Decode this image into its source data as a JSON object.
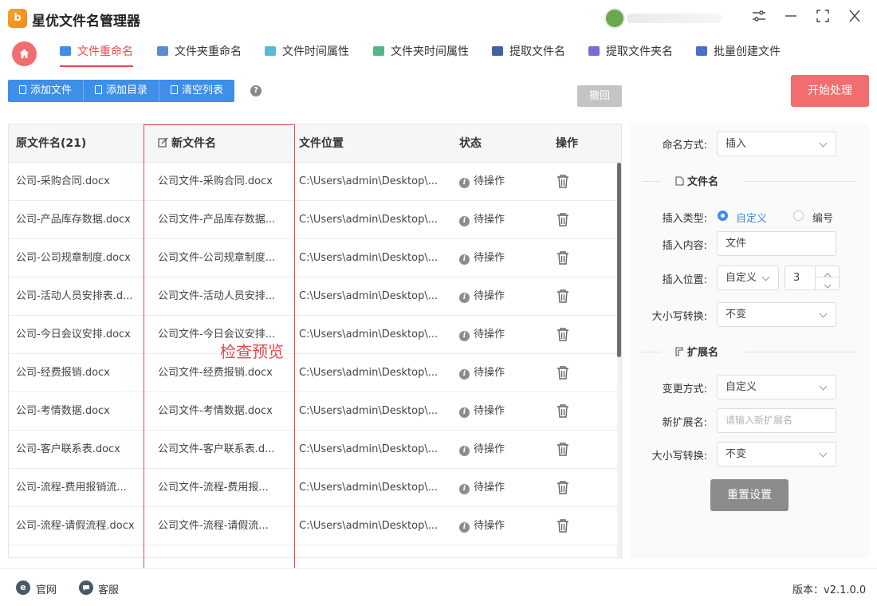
{
  "app": {
    "title": "星优文件名管理器",
    "logo_text": "b"
  },
  "tabs": [
    {
      "label": "文件重命名",
      "active": true,
      "icon": "rename-icon",
      "color": "#3d8fe8"
    },
    {
      "label": "文件夹重命名",
      "icon": "folder-rename-icon",
      "color": "#5d8ccf"
    },
    {
      "label": "文件时间属性",
      "icon": "file-time-icon",
      "color": "#5ab7d6"
    },
    {
      "label": "文件夹时间属性",
      "icon": "folder-time-icon",
      "color": "#4fb88a"
    },
    {
      "label": "提取文件名",
      "icon": "extract-filename-icon",
      "color": "#3e63a8"
    },
    {
      "label": "提取文件夹名",
      "icon": "extract-foldername-icon",
      "color": "#7c6ad6"
    },
    {
      "label": "批量创建文件",
      "icon": "batch-create-icon",
      "color": "#4a6fd0"
    }
  ],
  "toolbar": {
    "add_file": "添加文件",
    "add_dir": "添加目录",
    "clear_list": "清空列表",
    "help": "?",
    "undo": "撤回",
    "start": "开始处理"
  },
  "table": {
    "headers": {
      "original": "原文件名(21)",
      "new": "新文件名",
      "location": "文件位置",
      "status": "状态",
      "action": "操作"
    },
    "rows": [
      {
        "original": "公司-采购合同.docx",
        "new": "公司文件-采购合同.docx",
        "location": "C:\\Users\\admin\\Desktop\\...",
        "status": "待操作"
      },
      {
        "original": "公司-产品库存数据.docx",
        "new": "公司文件-产品库存数据...",
        "location": "C:\\Users\\admin\\Desktop\\...",
        "status": "待操作"
      },
      {
        "original": "公司-公司规章制度.docx",
        "new": "公司文件-公司规章制度...",
        "location": "C:\\Users\\admin\\Desktop\\...",
        "status": "待操作"
      },
      {
        "original": "公司-活动人员安排表.d...",
        "new": "公司文件-活动人员安排...",
        "location": "C:\\Users\\admin\\Desktop\\...",
        "status": "待操作"
      },
      {
        "original": "公司-今日会议安排.docx",
        "new": "公司文件-今日会议安排...",
        "location": "C:\\Users\\admin\\Desktop\\...",
        "status": "待操作"
      },
      {
        "original": "公司-经费报销.docx",
        "new": "公司文件-经费报销.docx",
        "location": "C:\\Users\\admin\\Desktop\\...",
        "status": "待操作"
      },
      {
        "original": "公司-考情数据.docx",
        "new": "公司文件-考情数据.docx",
        "location": "C:\\Users\\admin\\Desktop\\...",
        "status": "待操作"
      },
      {
        "original": "公司-客户联系表.docx",
        "new": "公司文件-客户联系表.d...",
        "location": "C:\\Users\\admin\\Desktop\\...",
        "status": "待操作"
      },
      {
        "original": "公司-流程-费用报销流...",
        "new": "公司文件-流程-费用报...",
        "location": "C:\\Users\\admin\\Desktop\\...",
        "status": "待操作"
      },
      {
        "original": "公司-流程-请假流程.docx",
        "new": "公司文件-流程-请假流...",
        "location": "C:\\Users\\admin\\Desktop\\...",
        "status": "待操作"
      },
      {
        "original": "",
        "new": "",
        "location": "",
        "status": ""
      }
    ]
  },
  "annotation": {
    "preview_label": "检查预览",
    "color": "#e24b4b"
  },
  "panel": {
    "naming_method_label": "命名方式:",
    "naming_method_value": "插入",
    "filename_section": "文件名",
    "insert_type_label": "插入类型:",
    "insert_type_options": [
      "自定义",
      "编号"
    ],
    "insert_type_selected": "自定义",
    "insert_content_label": "插入内容:",
    "insert_content_value": "文件",
    "insert_position_label": "插入位置:",
    "insert_position_value": "自定义",
    "insert_position_number": "3",
    "case_label": "大小写转换:",
    "case_value": "不变",
    "ext_section": "扩展名",
    "change_method_label": "变更方式:",
    "change_method_value": "自定义",
    "new_ext_label": "新扩展名:",
    "new_ext_placeholder": "请输入新扩展名",
    "ext_case_label": "大小写转换:",
    "ext_case_value": "不变",
    "reset": "重置设置"
  },
  "footer": {
    "website": "官网",
    "support": "客服",
    "version": "版本：v2.1.0.0"
  },
  "colors": {
    "accent": "#e64b4b",
    "primary": "#3d8fe8",
    "start_button": "#f26d6d",
    "reset_button": "#8b8b8b"
  }
}
